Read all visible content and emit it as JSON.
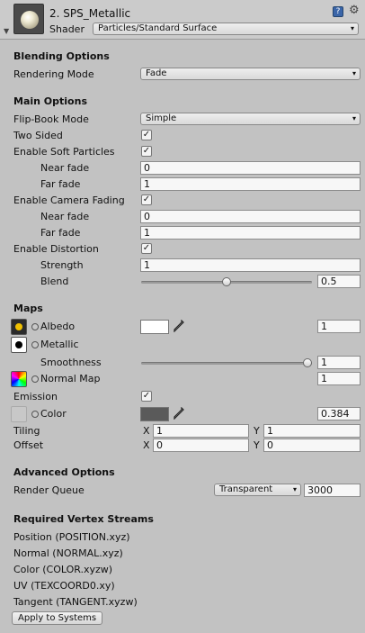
{
  "header": {
    "material_name": "2. SPS_Metallic",
    "shader_label": "Shader",
    "shader_value": "Particles/Standard Surface"
  },
  "blending": {
    "title": "Blending Options",
    "rendering_mode_label": "Rendering Mode",
    "rendering_mode_value": "Fade"
  },
  "main": {
    "title": "Main Options",
    "flipbook_label": "Flip-Book Mode",
    "flipbook_value": "Simple",
    "two_sided_label": "Two Sided",
    "soft_particles_label": "Enable Soft Particles",
    "soft_near_label": "Near fade",
    "soft_near_value": "0",
    "soft_far_label": "Far fade",
    "soft_far_value": "1",
    "camera_fading_label": "Enable Camera Fading",
    "cam_near_label": "Near fade",
    "cam_near_value": "0",
    "cam_far_label": "Far fade",
    "cam_far_value": "1",
    "distortion_label": "Enable Distortion",
    "strength_label": "Strength",
    "strength_value": "1",
    "blend_label": "Blend",
    "blend_value": "0.5",
    "blend_fraction": 0.5
  },
  "maps": {
    "title": "Maps",
    "albedo_label": "Albedo",
    "albedo_value": "1",
    "albedo_color": "#ffffff",
    "metallic_label": "Metallic",
    "smoothness_label": "Smoothness",
    "smoothness_value": "1",
    "smoothness_fraction": 1,
    "normal_label": "Normal Map",
    "normal_value": "1",
    "emission_label": "Emission",
    "color_label": "Color",
    "color_value": "0.384",
    "emission_color": "#5a5a5a",
    "tiling_label": "Tiling",
    "offset_label": "Offset",
    "x_axis": "X",
    "y_axis": "Y",
    "tiling_x": "1",
    "tiling_y": "1",
    "offset_x": "0",
    "offset_y": "0"
  },
  "advanced": {
    "title": "Advanced Options",
    "render_queue_label": "Render Queue",
    "render_queue_mode": "Transparent",
    "render_queue_value": "3000"
  },
  "streams": {
    "title": "Required Vertex Streams",
    "items": [
      "Position (POSITION.xyz)",
      "Normal (NORMAL.xyz)",
      "Color (COLOR.xyzw)",
      "UV (TEXCOORD0.xy)",
      "Tangent (TANGENT.xyzw)"
    ],
    "apply_button": "Apply to Systems"
  },
  "icons": {
    "help": "help-icon",
    "gear": "gear-icon",
    "eyedropper": "eyedropper-icon"
  },
  "colors": {
    "background": "#c2c2c2",
    "check": "#1a1a1a"
  }
}
